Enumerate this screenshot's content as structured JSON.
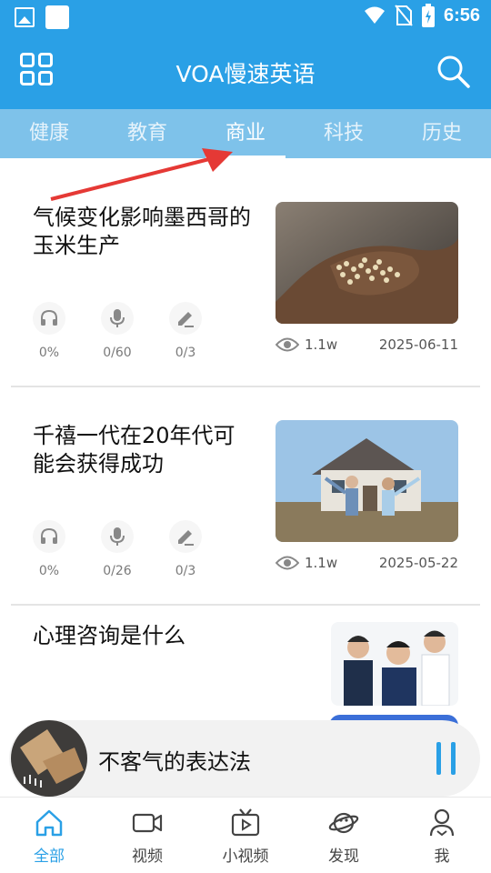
{
  "status_bar": {
    "time": "6:56"
  },
  "header": {
    "title": "VOA慢速英语",
    "menu_icon": "grid-menu-icon",
    "search_icon": "search-icon"
  },
  "tabs": [
    {
      "label": "健康",
      "active": false
    },
    {
      "label": "教育",
      "active": false
    },
    {
      "label": "商业",
      "active": true
    },
    {
      "label": "科技",
      "active": false
    },
    {
      "label": "历史",
      "active": false
    }
  ],
  "articles": [
    {
      "title": "气候变化影响墨西哥的玉米生产",
      "listen": "0%",
      "speak": "0/60",
      "write": "0/3",
      "views": "1.1w",
      "date": "2025-06-11"
    },
    {
      "title": "千禧一代在20年代可能会获得成功",
      "listen": "0%",
      "speak": "0/26",
      "write": "0/3",
      "views": "1.1w",
      "date": "2025-05-22"
    },
    {
      "title": "心理咨询是什么"
    }
  ],
  "player": {
    "title": "不客气的表达法"
  },
  "bottom_nav": [
    {
      "label": "全部",
      "icon": "home-icon",
      "active": true
    },
    {
      "label": "视频",
      "icon": "video-camera-icon",
      "active": false
    },
    {
      "label": "小视频",
      "icon": "tv-play-icon",
      "active": false
    },
    {
      "label": "发现",
      "icon": "planet-icon",
      "active": false
    },
    {
      "label": "我",
      "icon": "user-icon",
      "active": false
    }
  ],
  "colors": {
    "primary": "#2aa0e6",
    "tab_bg": "#7ec2ea",
    "annotation_arrow": "#e53935"
  }
}
